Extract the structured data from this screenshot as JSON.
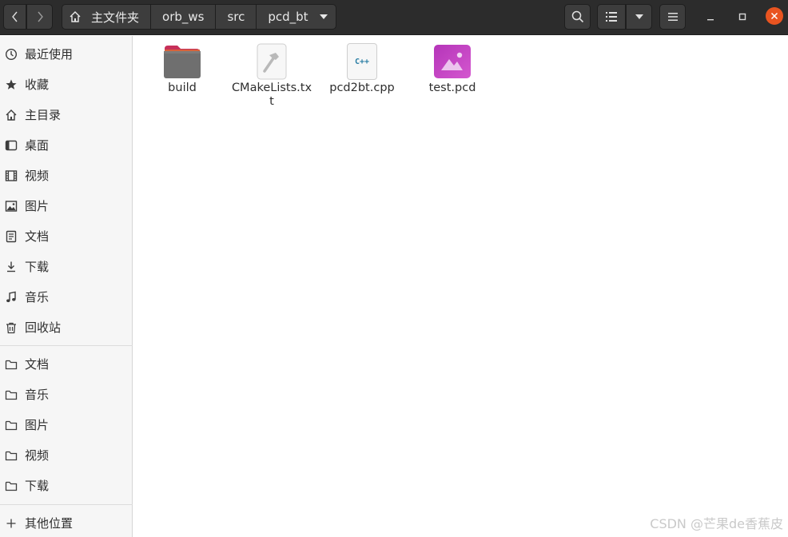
{
  "header": {
    "breadcrumbs": [
      "主文件夹",
      "orb_ws",
      "src",
      "pcd_bt"
    ]
  },
  "sidebar": {
    "places": [
      {
        "label": "最近使用",
        "icon": "clock-icon"
      },
      {
        "label": "收藏",
        "icon": "star-icon"
      },
      {
        "label": "主目录",
        "icon": "home-icon"
      },
      {
        "label": "桌面",
        "icon": "desktop-icon"
      },
      {
        "label": "视频",
        "icon": "film-icon"
      },
      {
        "label": "图片",
        "icon": "image-icon"
      },
      {
        "label": "文档",
        "icon": "document-icon"
      },
      {
        "label": "下载",
        "icon": "download-icon"
      },
      {
        "label": "音乐",
        "icon": "music-icon"
      },
      {
        "label": "回收站",
        "icon": "trash-icon"
      }
    ],
    "bookmarks": [
      {
        "label": "文档",
        "icon": "folder-icon"
      },
      {
        "label": "音乐",
        "icon": "folder-icon"
      },
      {
        "label": "图片",
        "icon": "folder-icon"
      },
      {
        "label": "视频",
        "icon": "folder-icon"
      },
      {
        "label": "下载",
        "icon": "folder-icon"
      }
    ],
    "other_locations": {
      "label": "其他位置",
      "icon": "plus-icon"
    }
  },
  "files": [
    {
      "name": "build",
      "type": "folder"
    },
    {
      "name": "CMakeLists.txt",
      "type": "cmake"
    },
    {
      "name": "pcd2bt.cpp",
      "type": "cpp",
      "badge": "C++"
    },
    {
      "name": "test.pcd",
      "type": "image"
    }
  ],
  "watermark": "CSDN @芒果de香蕉皮",
  "colors": {
    "header_bg": "#2c2c2c",
    "close_button": "#e95420",
    "sidebar_bg": "#f6f6f6",
    "folder_tab": "#c7305a",
    "folder_body": "#6f6f6f",
    "cpp_text": "#2a7ea4",
    "image_file": "#c045c4"
  }
}
